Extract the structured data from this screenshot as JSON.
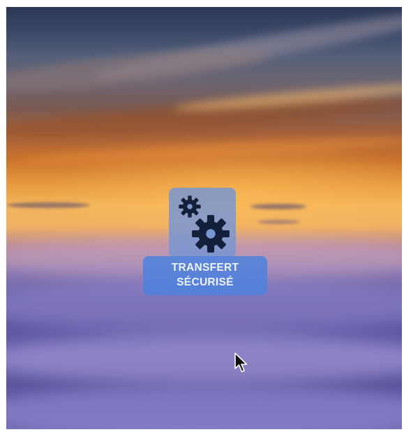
{
  "desktop": {
    "icon": {
      "label_line1": "TRANSFERT",
      "label_line2": "SÉCURISÉ",
      "glyph": "gears-icon"
    }
  },
  "colors": {
    "icon_tile": "#7896d2",
    "label_bg": "#5082dc",
    "gear": "#14203a"
  }
}
